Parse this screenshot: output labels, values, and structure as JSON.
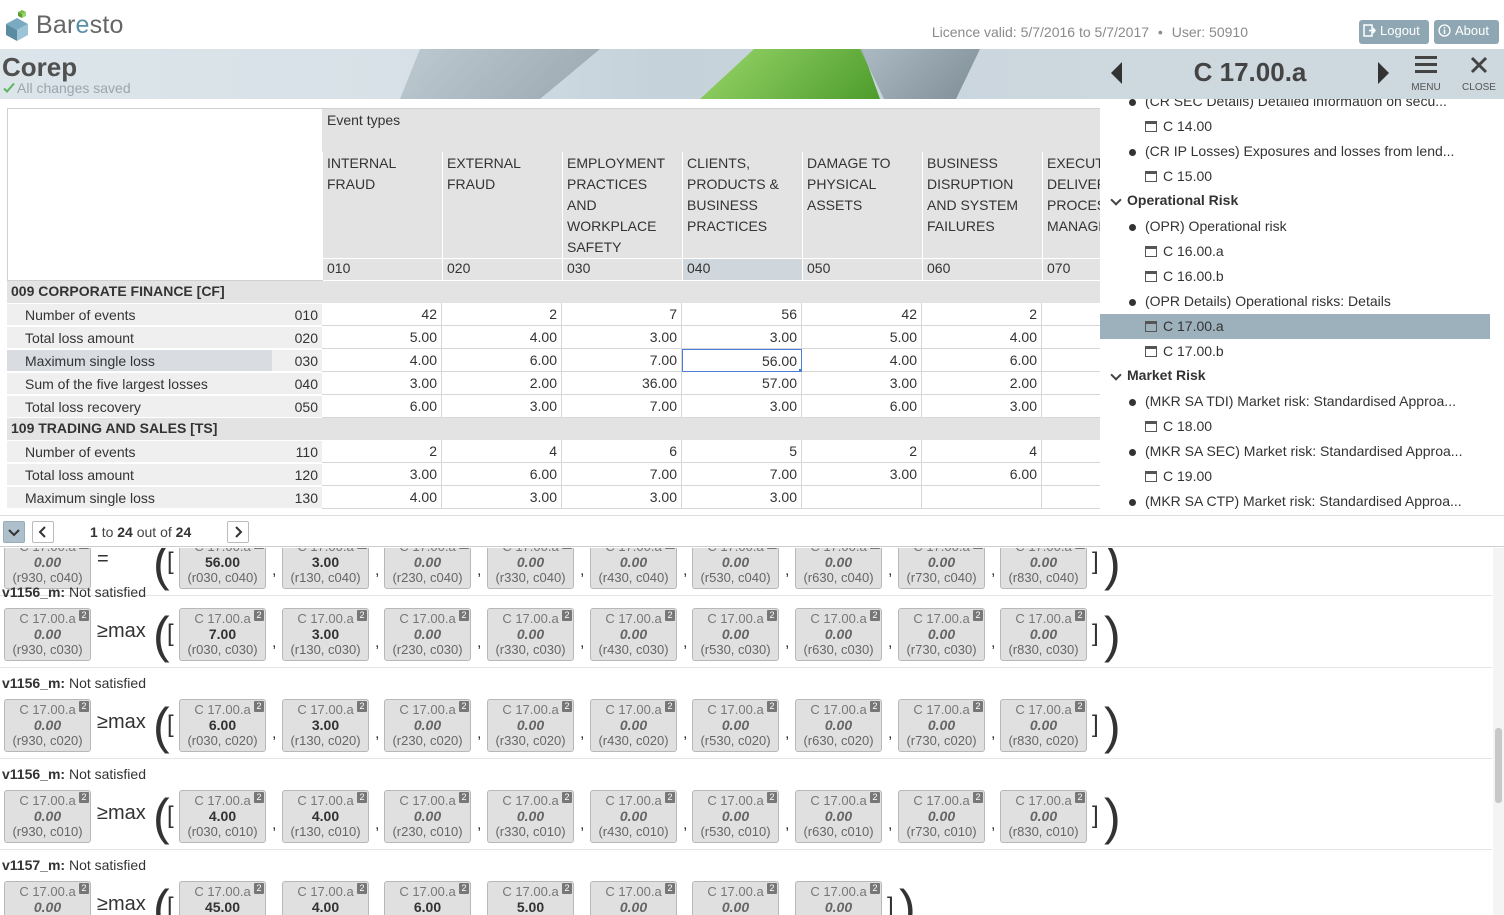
{
  "app": {
    "logo_text_a": "Bar",
    "logo_text_b": "e",
    "logo_text_c": "sto",
    "licence": "Licence valid: 5/7/2016 to 5/7/2017",
    "separator": "•",
    "user": "User: 50910",
    "logout_label": "Logout",
    "about_label": "About",
    "page_title": "Corep",
    "saved_status": "All changes saved",
    "accent_color": "#8fa7b3",
    "selected_color": "#9db1bd"
  },
  "panel": {
    "title": "C 17.00.a",
    "menu_label": "MENU",
    "close_label": "CLOSE",
    "items": [
      {
        "kind": "bullet",
        "label": "(CR SEC Details) Detailed information on secu..."
      },
      {
        "kind": "form",
        "label": "C 14.00"
      },
      {
        "kind": "bullet",
        "label": "(CR IP Losses) Exposures and losses from lend..."
      },
      {
        "kind": "form",
        "label": "C 15.00"
      },
      {
        "kind": "group",
        "label": "Operational Risk"
      },
      {
        "kind": "bullet",
        "label": "(OPR) Operational risk"
      },
      {
        "kind": "form",
        "label": "C 16.00.a"
      },
      {
        "kind": "form",
        "label": "C 16.00.b"
      },
      {
        "kind": "bullet",
        "label": "(OPR Details) Operational risks: Details"
      },
      {
        "kind": "form",
        "label": "C 17.00.a",
        "active": true
      },
      {
        "kind": "form",
        "label": "C 17.00.b"
      },
      {
        "kind": "group",
        "label": "Market Risk"
      },
      {
        "kind": "bullet",
        "label": "(MKR SA TDI) Market risk: Standardised Approa..."
      },
      {
        "kind": "form",
        "label": "C 18.00"
      },
      {
        "kind": "bullet",
        "label": "(MKR SA SEC) Market risk: Standardised Approa..."
      },
      {
        "kind": "form",
        "label": "C 19.00"
      },
      {
        "kind": "bullet",
        "label": "(MKR SA CTP) Market risk: Standardised Approa..."
      }
    ]
  },
  "grid": {
    "event_types_label": "Event types",
    "columns": [
      {
        "lines": [
          "INTERNAL",
          "FRAUD"
        ],
        "code": "010"
      },
      {
        "lines": [
          "EXTERNAL",
          "FRAUD"
        ],
        "code": "020"
      },
      {
        "lines": [
          "EMPLOYMENT",
          "PRACTICES",
          "AND",
          "WORKPLACE",
          "SAFETY"
        ],
        "code": "030"
      },
      {
        "lines": [
          "CLIENTS,",
          "PRODUCTS &",
          "BUSINESS",
          "PRACTICES"
        ],
        "code": "040",
        "selected": true
      },
      {
        "lines": [
          "DAMAGE TO",
          "PHYSICAL",
          "ASSETS"
        ],
        "code": "050"
      },
      {
        "lines": [
          "BUSINESS",
          "DISRUPTION",
          "AND SYSTEM",
          "FAILURES"
        ],
        "code": "060"
      },
      {
        "lines": [
          "EXECUTION,",
          "DELIVERY &",
          "PROCESS",
          "MANAGEMENT"
        ],
        "code": "070"
      }
    ],
    "sections": [
      {
        "title": "009 CORPORATE FINANCE [CF]",
        "rows": [
          {
            "label": "Number of events",
            "code": "010",
            "values": [
              "42",
              "2",
              "7",
              "56",
              "42",
              "2",
              ""
            ]
          },
          {
            "label": "Total loss amount",
            "code": "020",
            "values": [
              "5.00",
              "4.00",
              "3.00",
              "3.00",
              "5.00",
              "4.00",
              ""
            ]
          },
          {
            "label": "Maximum single loss",
            "code": "030",
            "values": [
              "4.00",
              "6.00",
              "7.00",
              "56.00",
              "4.00",
              "6.00",
              ""
            ],
            "selected": true
          },
          {
            "label": "Sum of the five largest losses",
            "code": "040",
            "values": [
              "3.00",
              "2.00",
              "36.00",
              "57.00",
              "3.00",
              "2.00",
              ""
            ]
          },
          {
            "label": "Total loss recovery",
            "code": "050",
            "values": [
              "6.00",
              "3.00",
              "7.00",
              "3.00",
              "6.00",
              "3.00",
              ""
            ]
          }
        ]
      },
      {
        "title": "109 TRADING AND SALES [TS]",
        "rows": [
          {
            "label": "Number of events",
            "code": "110",
            "values": [
              "2",
              "4",
              "6",
              "5",
              "2",
              "4",
              ""
            ]
          },
          {
            "label": "Total loss amount",
            "code": "120",
            "values": [
              "3.00",
              "6.00",
              "7.00",
              "7.00",
              "3.00",
              "6.00",
              ""
            ]
          },
          {
            "label": "Maximum single loss",
            "code": "130",
            "values": [
              "4.00",
              "3.00",
              "3.00",
              "3.00",
              "",
              "",
              ""
            ]
          }
        ]
      }
    ]
  },
  "pager": {
    "from": "1",
    "to_word": "to",
    "to": "24",
    "out_of_word": "out of",
    "total": "24"
  },
  "validations": {
    "form": "C 17.00.a",
    "badge": "2",
    "operator": "≥max",
    "items": [
      {
        "title": "",
        "status": "",
        "partial": true,
        "left": {
          "value": "0.00",
          "ref": "(r930, c040)"
        },
        "operator_partial": "=",
        "terms": [
          {
            "value": "56.00",
            "ref": "(r030, c040)"
          },
          {
            "value": "3.00",
            "ref": "(r130, c040)"
          },
          {
            "value": "0.00",
            "ref": "(r230, c040)"
          },
          {
            "value": "0.00",
            "ref": "(r330, c040)"
          },
          {
            "value": "0.00",
            "ref": "(r430, c040)"
          },
          {
            "value": "0.00",
            "ref": "(r530, c040)"
          },
          {
            "value": "0.00",
            "ref": "(r630, c040)"
          },
          {
            "value": "0.00",
            "ref": "(r730, c040)"
          },
          {
            "value": "0.00",
            "ref": "(r830, c040)"
          }
        ]
      },
      {
        "title": "v1156_m:",
        "status": "Not satisfied",
        "left": {
          "value": "0.00",
          "ref": "(r930, c030)"
        },
        "terms": [
          {
            "value": "7.00",
            "ref": "(r030, c030)"
          },
          {
            "value": "3.00",
            "ref": "(r130, c030)"
          },
          {
            "value": "0.00",
            "ref": "(r230, c030)"
          },
          {
            "value": "0.00",
            "ref": "(r330, c030)"
          },
          {
            "value": "0.00",
            "ref": "(r430, c030)"
          },
          {
            "value": "0.00",
            "ref": "(r530, c030)"
          },
          {
            "value": "0.00",
            "ref": "(r630, c030)"
          },
          {
            "value": "0.00",
            "ref": "(r730, c030)"
          },
          {
            "value": "0.00",
            "ref": "(r830, c030)"
          }
        ]
      },
      {
        "title": "v1156_m:",
        "status": "Not satisfied",
        "left": {
          "value": "0.00",
          "ref": "(r930, c020)"
        },
        "terms": [
          {
            "value": "6.00",
            "ref": "(r030, c020)"
          },
          {
            "value": "3.00",
            "ref": "(r130, c020)"
          },
          {
            "value": "0.00",
            "ref": "(r230, c020)"
          },
          {
            "value": "0.00",
            "ref": "(r330, c020)"
          },
          {
            "value": "0.00",
            "ref": "(r430, c020)"
          },
          {
            "value": "0.00",
            "ref": "(r530, c020)"
          },
          {
            "value": "0.00",
            "ref": "(r630, c020)"
          },
          {
            "value": "0.00",
            "ref": "(r730, c020)"
          },
          {
            "value": "0.00",
            "ref": "(r830, c020)"
          }
        ]
      },
      {
        "title": "v1156_m:",
        "status": "Not satisfied",
        "left": {
          "value": "0.00",
          "ref": "(r930, c010)"
        },
        "terms": [
          {
            "value": "4.00",
            "ref": "(r030, c010)"
          },
          {
            "value": "4.00",
            "ref": "(r130, c010)"
          },
          {
            "value": "0.00",
            "ref": "(r230, c010)"
          },
          {
            "value": "0.00",
            "ref": "(r330, c010)"
          },
          {
            "value": "0.00",
            "ref": "(r430, c010)"
          },
          {
            "value": "0.00",
            "ref": "(r530, c010)"
          },
          {
            "value": "0.00",
            "ref": "(r630, c010)"
          },
          {
            "value": "0.00",
            "ref": "(r730, c010)"
          },
          {
            "value": "0.00",
            "ref": "(r830, c010)"
          }
        ]
      },
      {
        "title": "v1157_m:",
        "status": "Not satisfied",
        "left": {
          "value": "0.00",
          "ref": ""
        },
        "terms": [
          {
            "value": "45.00",
            "ref": ""
          },
          {
            "value": "4.00",
            "ref": ""
          },
          {
            "value": "6.00",
            "ref": ""
          },
          {
            "value": "5.00",
            "ref": ""
          },
          {
            "value": "0.00",
            "ref": ""
          },
          {
            "value": "0.00",
            "ref": ""
          },
          {
            "value": "0.00",
            "ref": ""
          }
        ]
      }
    ]
  }
}
